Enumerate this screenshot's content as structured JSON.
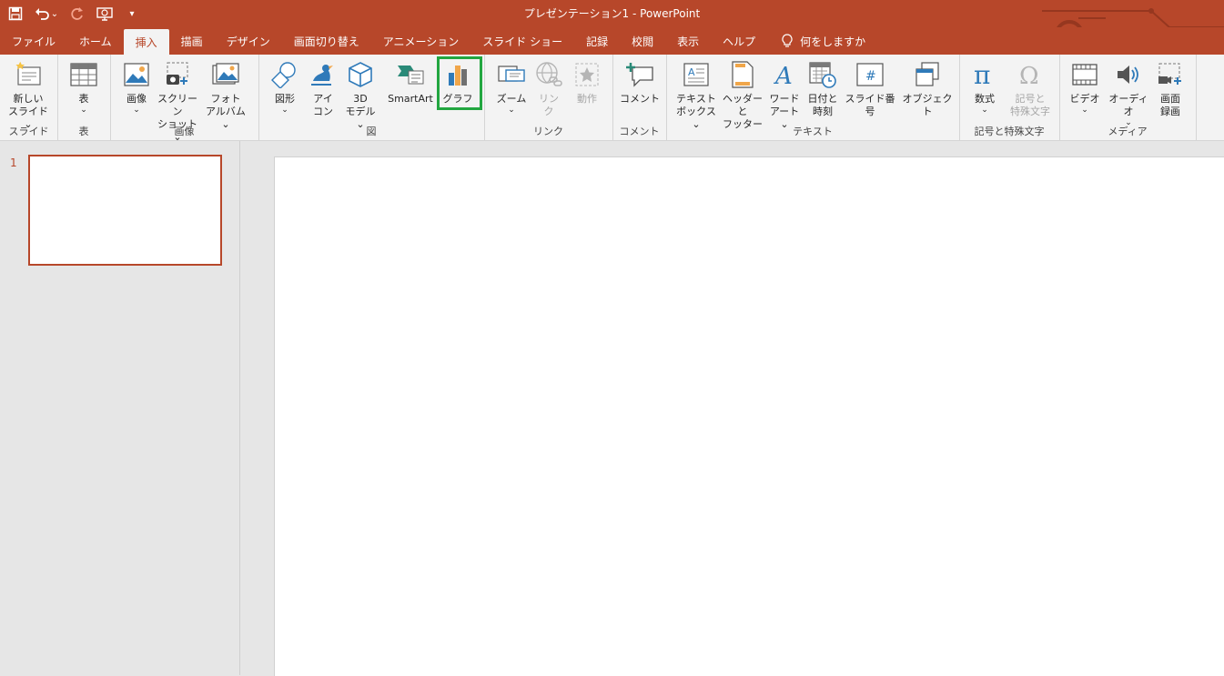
{
  "window": {
    "title": "プレゼンテーション1  -  PowerPoint"
  },
  "qat": {
    "icons": [
      "save-icon",
      "undo-icon",
      "redo-icon",
      "present-icon",
      "customize-icon"
    ],
    "undo_chevron": "⌄",
    "customize_glyph": "▾"
  },
  "tabs": [
    "ファイル",
    "ホーム",
    "挿入",
    "描画",
    "デザイン",
    "画面切り替え",
    "アニメーション",
    "スライド ショー",
    "記録",
    "校閲",
    "表示",
    "ヘルプ"
  ],
  "active_tab": "挿入",
  "tell_me": "何をしますか",
  "ribbon": {
    "groups": {
      "slides": "スライド",
      "tables": "表",
      "images": "画像",
      "illustrations": "図",
      "links": "リンク",
      "comments": "コメント",
      "text": "テキスト",
      "symbols": "記号と特殊文字",
      "media": "メディア"
    },
    "buttons": {
      "new_slide": [
        "新しい",
        "スライド ⌄"
      ],
      "table": [
        "表",
        "⌄"
      ],
      "picture": [
        "画像",
        "⌄"
      ],
      "screenshot": [
        "スクリーン",
        "ショット ⌄"
      ],
      "photo_album": [
        "フォト",
        "アルバム ⌄"
      ],
      "shapes": [
        "図形",
        "⌄"
      ],
      "icons": [
        "アイ",
        "コン"
      ],
      "model3d": [
        "3D",
        "モデル ⌄"
      ],
      "smartart": "SmartArt",
      "chart": "グラフ",
      "zoom": [
        "ズーム",
        "⌄"
      ],
      "link": [
        "リン",
        "ク"
      ],
      "action": "動作",
      "comment": "コメント",
      "textbox": [
        "テキスト",
        "ボックス ⌄"
      ],
      "header_footer": [
        "ヘッダーと",
        "フッター"
      ],
      "wordart": [
        "ワード",
        "アート ⌄"
      ],
      "datetime": [
        "日付と",
        "時刻"
      ],
      "slide_number": "スライド番号",
      "object": "オブジェクト",
      "equation": [
        "数式",
        "⌄"
      ],
      "symbol": [
        "記号と",
        "特殊文字"
      ],
      "video": [
        "ビデオ",
        "⌄"
      ],
      "audio": [
        "オーディオ",
        "⌄"
      ],
      "screen_recording": [
        "画面",
        "録画"
      ]
    }
  },
  "slides": {
    "count_label": "1"
  },
  "colors": {
    "accent": "#b7472a",
    "highlight": "#22a640"
  }
}
